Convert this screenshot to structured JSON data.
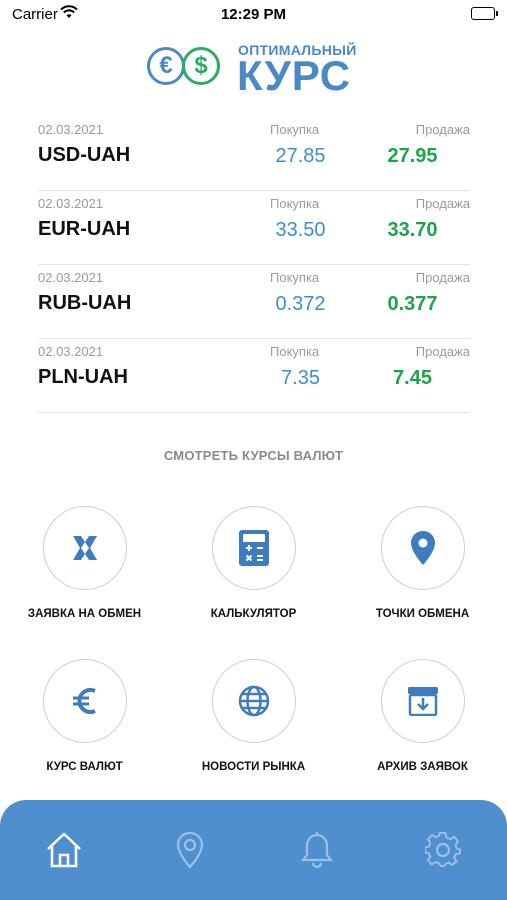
{
  "status": {
    "carrier": "Carrier",
    "time": "12:29 PM"
  },
  "logo": {
    "small": "ОПТИМАЛЬНЫЙ",
    "big": "КУРС"
  },
  "rates": [
    {
      "date": "02.03.2021",
      "pair": "USD-UAH",
      "buy_label": "Покупка",
      "buy": "27.85",
      "sell_label": "Продажа",
      "sell": "27.95"
    },
    {
      "date": "02.03.2021",
      "pair": "EUR-UAH",
      "buy_label": "Покупка",
      "buy": "33.50",
      "sell_label": "Продажа",
      "sell": "33.70"
    },
    {
      "date": "02.03.2021",
      "pair": "RUB-UAH",
      "buy_label": "Покупка",
      "buy": "0.372",
      "sell_label": "Продажа",
      "sell": "0.377"
    },
    {
      "date": "02.03.2021",
      "pair": "PLN-UAH",
      "buy_label": "Покупка",
      "buy": "7.35",
      "sell_label": "Продажа",
      "sell": "7.45"
    }
  ],
  "section_title": "СМОТРЕТЬ КУРСЫ ВАЛЮТ",
  "actions": [
    {
      "label": "ЗАЯВКА НА ОБМЕН",
      "icon": "exchange-icon"
    },
    {
      "label": "КАЛЬКУЛЯТОР",
      "icon": "calculator-icon"
    },
    {
      "label": "ТОЧКИ ОБМЕНА",
      "icon": "location-pin-icon"
    },
    {
      "label": "КУРС ВАЛЮТ",
      "icon": "euro-icon"
    },
    {
      "label": "НОВОСТИ РЫНКА",
      "icon": "globe-icon"
    },
    {
      "label": "АРХИВ ЗАЯВОК",
      "icon": "archive-icon"
    }
  ],
  "tabbar": {
    "active": "home",
    "tabs": [
      "home-icon",
      "map-pin-icon",
      "bell-icon",
      "settings-gear-icon"
    ]
  },
  "colors": {
    "accent_blue": "#4a89c8",
    "buy_blue": "#3a8fd3",
    "sell_green": "#1ea34b",
    "tabbar": "#4f8fcf"
  }
}
